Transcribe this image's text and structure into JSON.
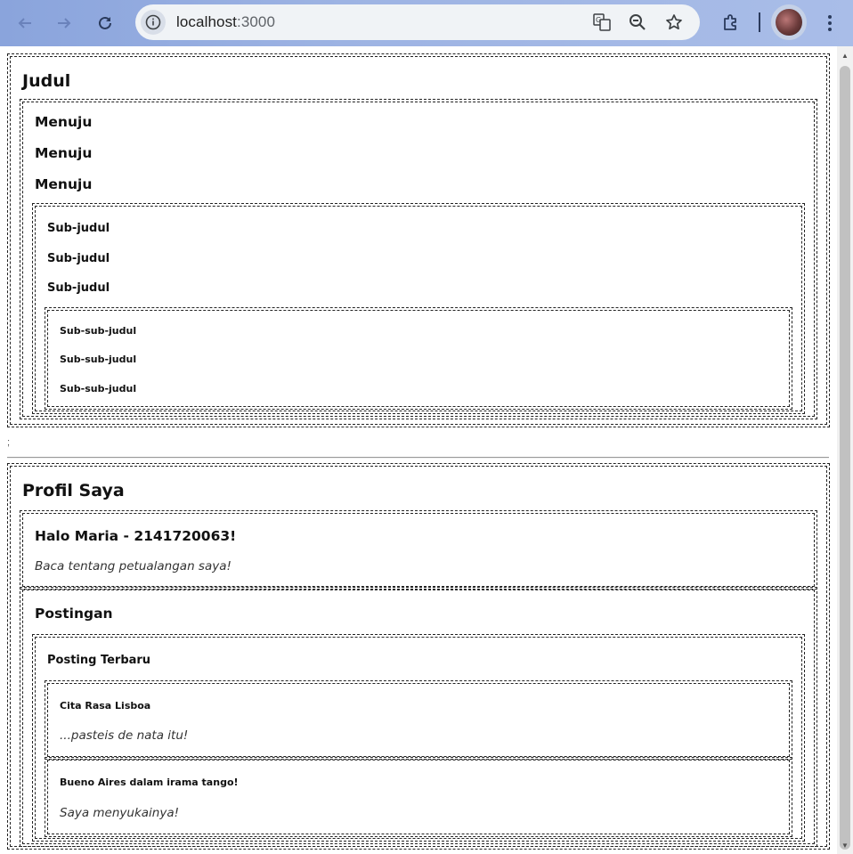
{
  "browser": {
    "url_host": "localhost",
    "url_port": ":3000"
  },
  "headings": {
    "judul": "Judul",
    "menuju": [
      "Menuju",
      "Menuju",
      "Menuju"
    ],
    "sub_judul": [
      "Sub-judul",
      "Sub-judul",
      "Sub-judul"
    ],
    "sub_sub_judul": [
      "Sub-sub-judul",
      "Sub-sub-judul",
      "Sub-sub-judul"
    ]
  },
  "separator_text": ";",
  "profile": {
    "title": "Profil Saya",
    "greeting": "Halo Maria - 2141720063!",
    "tagline": "Baca tentang petualangan saya!",
    "posts_title": "Postingan",
    "latest_title": "Posting Terbaru",
    "posts": [
      {
        "title": "Cita Rasa Lisboa",
        "excerpt": "...pasteis de nata itu!"
      },
      {
        "title": "Bueno Aires dalam irama tango!",
        "excerpt": "Saya menyukainya!"
      }
    ]
  }
}
